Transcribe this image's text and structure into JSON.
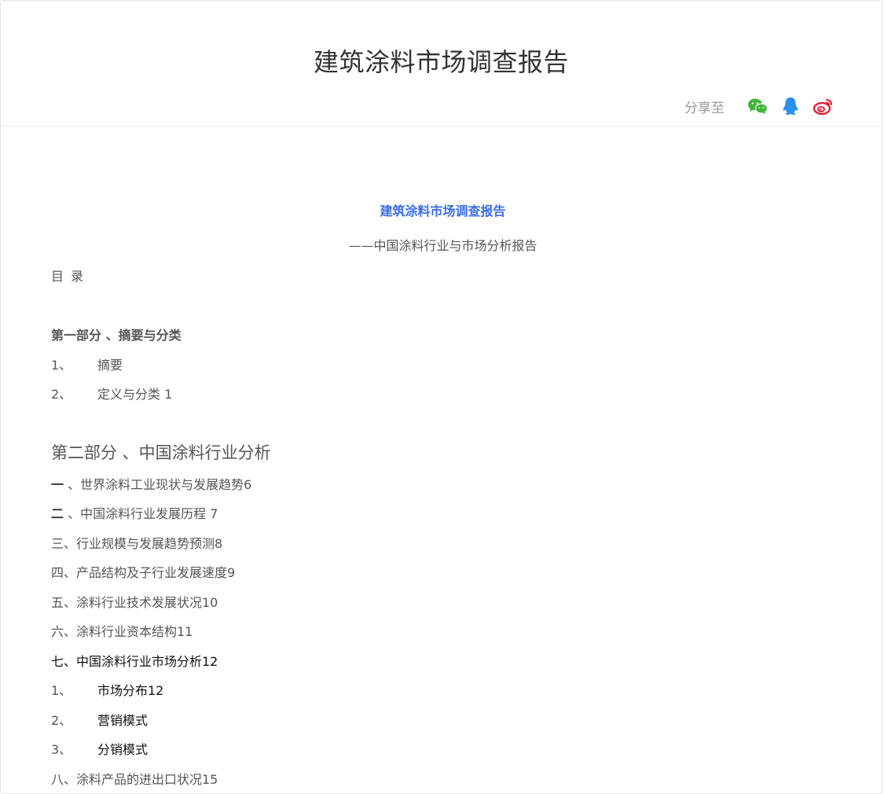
{
  "header": {
    "title": "建筑涂料市场调查报告",
    "share_label": "分享至",
    "share_icons": [
      "wechat-icon",
      "qq-icon",
      "weibo-icon"
    ],
    "colors": {
      "wechat": "#3fb536",
      "qq": "#2b8ff0",
      "weibo": "#e6162d"
    }
  },
  "document": {
    "title": "建筑涂料市场调查报告",
    "subtitle": "——中国涂料行业与市场分析报告",
    "toc_heading": "目 录",
    "part1_heading": "第一部分 、摘要与分类",
    "part1_items": [
      {
        "num": "1、",
        "text": "摘要"
      },
      {
        "num": "2、",
        "text": "定义与分类 1"
      }
    ],
    "part2_heading": "第二部分 、中国涂料行业分析",
    "part2_items": [
      {
        "lead": "一",
        "text": " 、世界涂料工业现状与发展趋势6"
      },
      {
        "lead": "二",
        "text": " 、中国涂料行业发展历程 7"
      },
      {
        "text": "三、行业规模与发展趋势预测8"
      },
      {
        "text": "四、产品结构及子行业发展速度9"
      },
      {
        "text": "五、涂料行业技术发展状况10"
      },
      {
        "text": "六、涂料行业资本结构11"
      },
      {
        "text": "七、中国涂料行业市场分析12"
      }
    ],
    "section7_items": [
      {
        "num": "1、",
        "text": "市场分布12"
      },
      {
        "num": "2、",
        "text": "营销模式"
      },
      {
        "num": "3、",
        "text": "分销模式"
      }
    ],
    "section8": "八、涂料产品的进出口状况15"
  }
}
